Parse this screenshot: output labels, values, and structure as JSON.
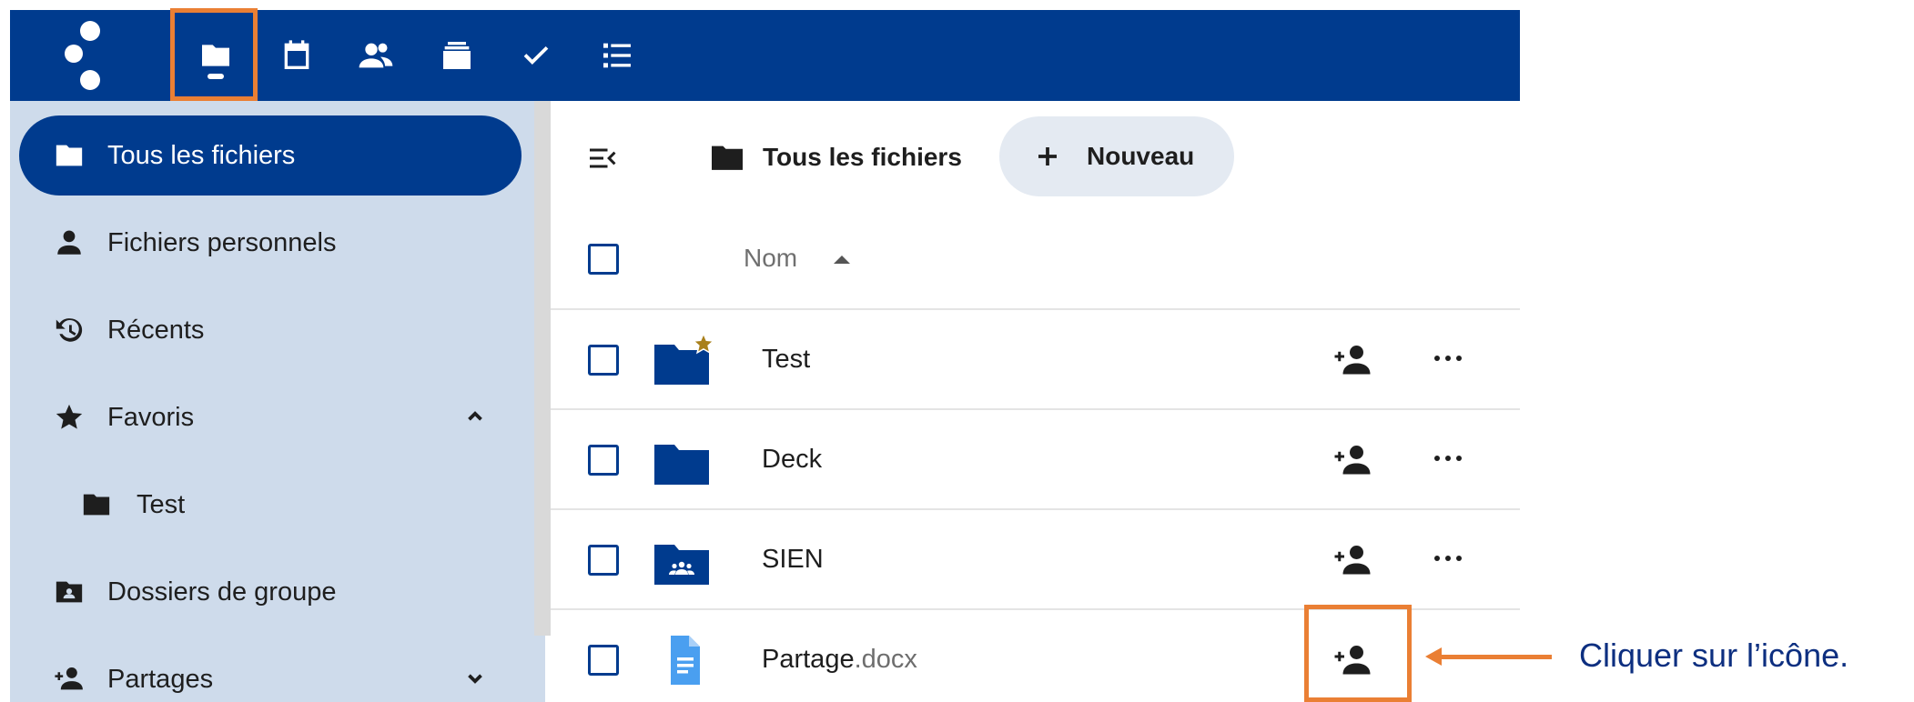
{
  "header": {
    "apps": [
      {
        "icon": "folder-icon",
        "name": "files"
      },
      {
        "icon": "calendar-icon",
        "name": "calendar"
      },
      {
        "icon": "contacts-icon",
        "name": "contacts"
      },
      {
        "icon": "deck-icon",
        "name": "deck"
      },
      {
        "icon": "checkmark-icon",
        "name": "tasks"
      },
      {
        "icon": "list-icon",
        "name": "list"
      }
    ],
    "active_app": "files"
  },
  "sidebar": {
    "items": [
      {
        "label": "Tous les fichiers",
        "icon": "folder-icon",
        "active": true
      },
      {
        "label": "Fichiers personnels",
        "icon": "person-icon"
      },
      {
        "label": "Récents",
        "icon": "history-icon"
      },
      {
        "label": "Favoris",
        "icon": "star-icon",
        "expanded": true
      },
      {
        "label": "Test",
        "icon": "folder-icon",
        "sub": true
      },
      {
        "label": "Dossiers de groupe",
        "icon": "group-folder-icon"
      },
      {
        "label": "Partages",
        "icon": "share-icon",
        "expanded": false
      }
    ]
  },
  "main": {
    "breadcrumb": "Tous les fichiers",
    "new_button": "Nouveau",
    "columns": {
      "name": "Nom"
    },
    "files": [
      {
        "name": "Test",
        "ext": "",
        "icon": "folder-star-icon",
        "favorite": true
      },
      {
        "name": "Deck",
        "ext": "",
        "icon": "folder-icon"
      },
      {
        "name": "SIEN",
        "ext": "",
        "icon": "group-folder-icon"
      },
      {
        "name": "Partage",
        "ext": ".docx",
        "icon": "document-icon"
      }
    ]
  },
  "annotation": {
    "text": "Cliquer sur l’icône."
  },
  "colors": {
    "primary": "#003b8e",
    "sidebar_bg": "#cedbeb",
    "highlight": "#ea7f34",
    "annotation_text": "#0d2f80"
  }
}
